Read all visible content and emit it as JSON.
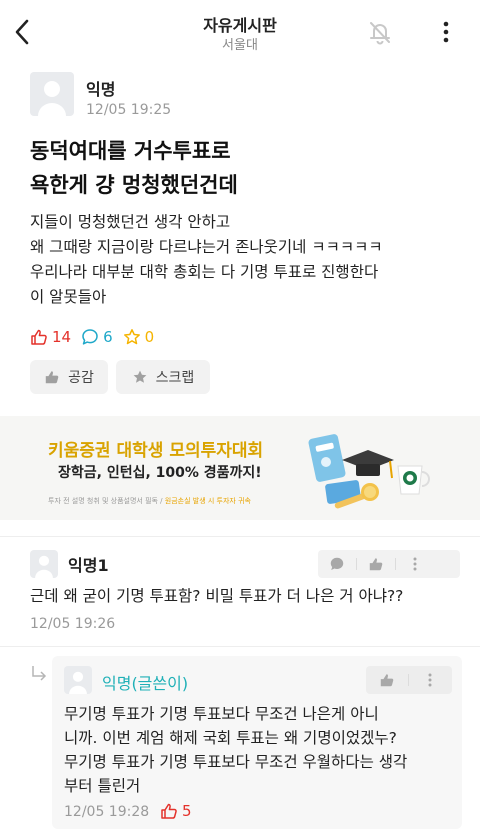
{
  "header": {
    "title": "자유게시판",
    "subtitle": "서울대"
  },
  "post": {
    "author": "익명",
    "time": "12/05 19:25",
    "title_lines": [
      "동덕여대를 거수투표로",
      "욕한게 걍 멍청했던건데"
    ],
    "body_lines": [
      "지들이 멍청했던건 생각 안하고",
      "왜 그때랑 지금이랑 다르냐는거 존나웃기네 ㅋㅋㅋㅋㅋ",
      "우리나라 대부분 대학 총회는 다 기명 투표로 진행한다",
      "이 알못들아"
    ],
    "stats": {
      "likes": "14",
      "comments": "6",
      "scraps": "0"
    },
    "actions": {
      "like_label": "공감",
      "scrap_label": "스크랩"
    }
  },
  "ad": {
    "title": "키움증권 대학생 모의투자대회",
    "subtitle": "장학금, 인턴십, 100% 경품까지!",
    "fine_print": "투자 전 설명 청취 및 상품설명서 필독 / 원금손실 발생 시 투자자 귀속",
    "fine_print_highlight": "원금손실 발생 시 투자자 귀속",
    "fine_print_prefix": "투자 전 설명 청취 및 상품설명서 필독 / "
  },
  "comments": [
    {
      "author": "익명1",
      "text_lines": [
        "근데 왜 굳이 기명 투표함? 비밀 투표가 더 나은 거 아냐??"
      ],
      "time": "12/05 19:26"
    }
  ],
  "reply": {
    "author": "익명(글쓴이)",
    "text_lines": [
      "무기명 투표가 기명 투표보다 무조건 나은게 아니",
      "니까. 이번 계엄 해제 국회 투표는 왜 기명이었겠누?",
      "무기명 투표가 기명 투표보다 무조건 우월하다는 생각",
      "부터 틀린거"
    ],
    "time": "12/05 19:28",
    "likes": "5"
  },
  "colors": {
    "like_red": "#e4322b",
    "comment_teal": "#1fa8c9",
    "scrap_yellow": "#f5b400",
    "op_name_teal": "#1fb0b7",
    "ad_gold": "#d9a300"
  },
  "icons": {
    "back": "chevron-left-icon",
    "bell": "bell-off-icon",
    "more": "vertical-dots-icon",
    "like": "thumbs-up-icon",
    "comment": "speech-bubble-icon",
    "scrap": "star-icon",
    "reply": "reply-arrow-icon"
  }
}
